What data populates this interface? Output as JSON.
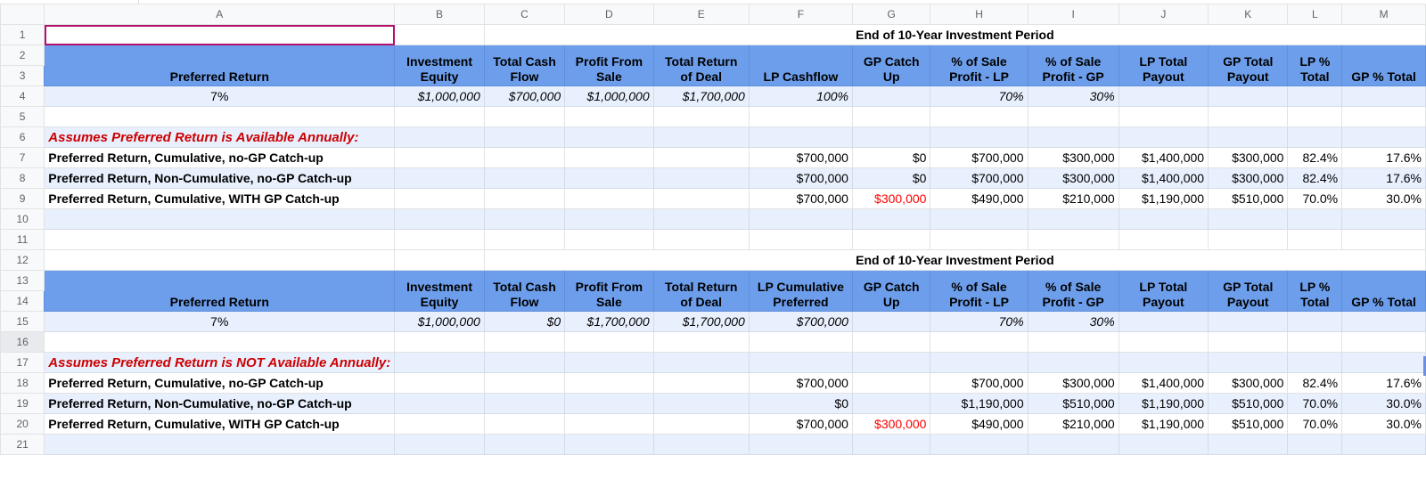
{
  "columns": [
    "",
    "A",
    "B",
    "C",
    "D",
    "E",
    "F",
    "G",
    "H",
    "I",
    "J",
    "K",
    "L",
    "M"
  ],
  "rows": [
    "1",
    "2",
    "3",
    "4",
    "5",
    "6",
    "7",
    "8",
    "9",
    "10",
    "11",
    "12",
    "13",
    "14",
    "15",
    "16",
    "17",
    "18",
    "19",
    "20",
    "21"
  ],
  "colors": {
    "header_fill": "#6d9eeb",
    "band_fill": "#e8f0fe",
    "section_text": "#cc0000",
    "catchup_text": "#ff0000",
    "selection_border": "#b3126b"
  },
  "table1": {
    "period_title": "End of 10-Year Investment Period",
    "headers": [
      "Preferred Return",
      "Investment Equity",
      "Total Cash Flow",
      "Profit From Sale",
      "Total Return of Deal",
      "LP Cashflow",
      "GP Catch Up",
      "% of Sale Profit - LP",
      "% of Sale Profit - GP",
      "LP Total Payout",
      "GP Total Payout",
      "LP % Total",
      "GP % Total"
    ],
    "inputs": [
      "7%",
      "$1,000,000",
      "$700,000",
      "$1,000,000",
      "$1,700,000",
      "100%",
      "",
      "70%",
      "30%",
      "",
      "",
      "",
      ""
    ],
    "section_label": "Assumes Preferred Return is Available Annually:",
    "scenarios": [
      {
        "label": "Preferred Return, Cumulative, no-GP Catch-up",
        "lp_cashflow": "$700,000",
        "gp_catch_up": "$0",
        "sale_lp": "$700,000",
        "sale_gp": "$300,000",
        "lp_total": "$1,400,000",
        "gp_total": "$300,000",
        "lp_pct": "82.4%",
        "gp_pct": "17.6%"
      },
      {
        "label": "Preferred Return, Non-Cumulative, no-GP Catch-up",
        "lp_cashflow": "$700,000",
        "gp_catch_up": "$0",
        "sale_lp": "$700,000",
        "sale_gp": "$300,000",
        "lp_total": "$1,400,000",
        "gp_total": "$300,000",
        "lp_pct": "82.4%",
        "gp_pct": "17.6%"
      },
      {
        "label": "Preferred Return, Cumulative, WITH GP Catch-up",
        "lp_cashflow": "$700,000",
        "gp_catch_up": "$300,000",
        "sale_lp": "$490,000",
        "sale_gp": "$210,000",
        "lp_total": "$1,190,000",
        "gp_total": "$510,000",
        "lp_pct": "70.0%",
        "gp_pct": "30.0%"
      }
    ]
  },
  "table2": {
    "period_title": "End of 10-Year Investment Period",
    "headers": [
      "Preferred Return",
      "Investment Equity",
      "Total Cash Flow",
      "Profit From Sale",
      "Total Return of Deal",
      "LP Cumulative Preferred",
      "GP Catch Up",
      "% of Sale Profit - LP",
      "% of Sale Profit - GP",
      "LP Total Payout",
      "GP Total Payout",
      "LP % Total",
      "GP % Total"
    ],
    "inputs": [
      "7%",
      "$1,000,000",
      "$0",
      "$1,700,000",
      "$1,700,000",
      "$700,000",
      "",
      "70%",
      "30%",
      "",
      "",
      "",
      ""
    ],
    "section_label": "Assumes Preferred Return is NOT Available Annually:",
    "scenarios": [
      {
        "label": "Preferred Return, Cumulative, no-GP Catch-up",
        "lp_cashflow": "$700,000",
        "gp_catch_up": "",
        "sale_lp": "$700,000",
        "sale_gp": "$300,000",
        "lp_total": "$1,400,000",
        "gp_total": "$300,000",
        "lp_pct": "82.4%",
        "gp_pct": "17.6%"
      },
      {
        "label": "Preferred Return, Non-Cumulative, no-GP Catch-up",
        "lp_cashflow": "$0",
        "gp_catch_up": "",
        "sale_lp": "$1,190,000",
        "sale_gp": "$510,000",
        "lp_total": "$1,190,000",
        "gp_total": "$510,000",
        "lp_pct": "70.0%",
        "gp_pct": "30.0%"
      },
      {
        "label": "Preferred Return, Cumulative, WITH GP Catch-up",
        "lp_cashflow": "$700,000",
        "gp_catch_up": "$300,000",
        "sale_lp": "$490,000",
        "sale_gp": "$210,000",
        "lp_total": "$1,190,000",
        "gp_total": "$510,000",
        "lp_pct": "70.0%",
        "gp_pct": "30.0%"
      }
    ]
  }
}
